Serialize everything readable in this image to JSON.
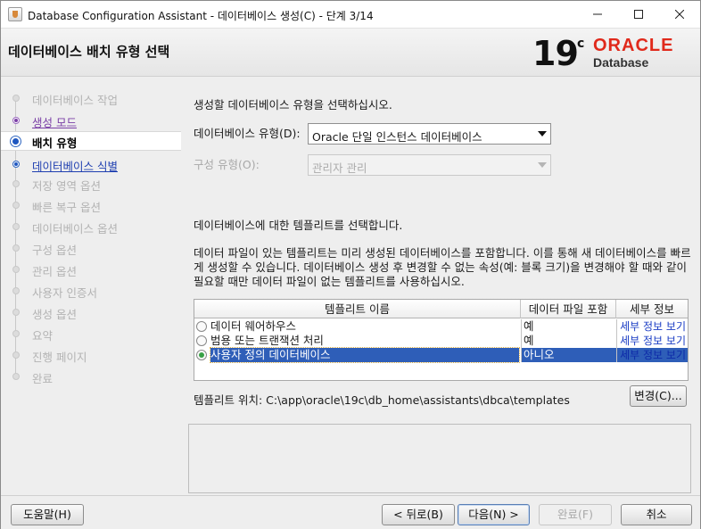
{
  "window": {
    "title": "Database Configuration Assistant - 데이터베이스 생성(C) - 단계 3/14"
  },
  "header": {
    "title": "데이터베이스 배치 유형 선택",
    "logo_version": "19",
    "logo_sup": "c",
    "logo_brand": "ORACLE",
    "logo_sub": "Database"
  },
  "steps": [
    {
      "label": "데이터베이스 작업",
      "state": "disabled"
    },
    {
      "label": "생성 모드",
      "state": "done"
    },
    {
      "label": "배치 유형",
      "state": "current"
    },
    {
      "label": "데이터베이스 식별",
      "state": "link"
    },
    {
      "label": "저장 영역 옵션",
      "state": "disabled"
    },
    {
      "label": "빠른 복구 옵션",
      "state": "disabled"
    },
    {
      "label": "데이터베이스 옵션",
      "state": "disabled"
    },
    {
      "label": "구성 옵션",
      "state": "disabled"
    },
    {
      "label": "관리 옵션",
      "state": "disabled"
    },
    {
      "label": "사용자 인증서",
      "state": "disabled"
    },
    {
      "label": "생성 옵션",
      "state": "disabled"
    },
    {
      "label": "요약",
      "state": "disabled"
    },
    {
      "label": "진행 페이지",
      "state": "disabled"
    },
    {
      "label": "완료",
      "state": "disabled"
    }
  ],
  "content": {
    "instruction": "생성할 데이터베이스 유형을 선택하십시오.",
    "db_type_label": "데이터베이스 유형(D):",
    "db_type_value": "Oracle 단일 인스턴스 데이터베이스",
    "config_type_label": "구성 유형(O):",
    "config_type_value": "관리자 관리",
    "template_instruction": "데이터베이스에 대한 템플리트를 선택합니다.",
    "template_description": "데이터 파일이 있는 템플리트는 미리 생성된 데이터베이스를 포함합니다. 이를 통해 새 데이터베이스를 빠르게 생성할 수 있습니다. 데이터베이스 생성 후 변경할 수 없는 속성(예: 블록 크기)을 변경해야 할 때와 같이 필요할 때만 데이터 파일이 없는 템플리트를 사용하십시오.",
    "table": {
      "headers": [
        "템플리트 이름",
        "데이터 파일 포함",
        "세부 정보"
      ],
      "rows": [
        {
          "name": "데이터 웨어하우스",
          "includes_datafiles": "예",
          "details": "세부 정보 보기",
          "selected": false
        },
        {
          "name": "범용 또는 트랜잭션 처리",
          "includes_datafiles": "예",
          "details": "세부 정보 보기",
          "selected": false
        },
        {
          "name": "사용자 정의 데이터베이스",
          "includes_datafiles": "아니오",
          "details": "세부 정보 보기",
          "selected": true
        }
      ]
    },
    "template_location": "템플리트 위치: C:\\app\\oracle\\19c\\db_home\\assistants\\dbca\\templates",
    "change_button": "변경(C)..."
  },
  "footer": {
    "help": "도움말(H)",
    "back": "< 뒤로(B)",
    "next": "다음(N) >",
    "finish": "완료(F)",
    "cancel": "취소"
  }
}
